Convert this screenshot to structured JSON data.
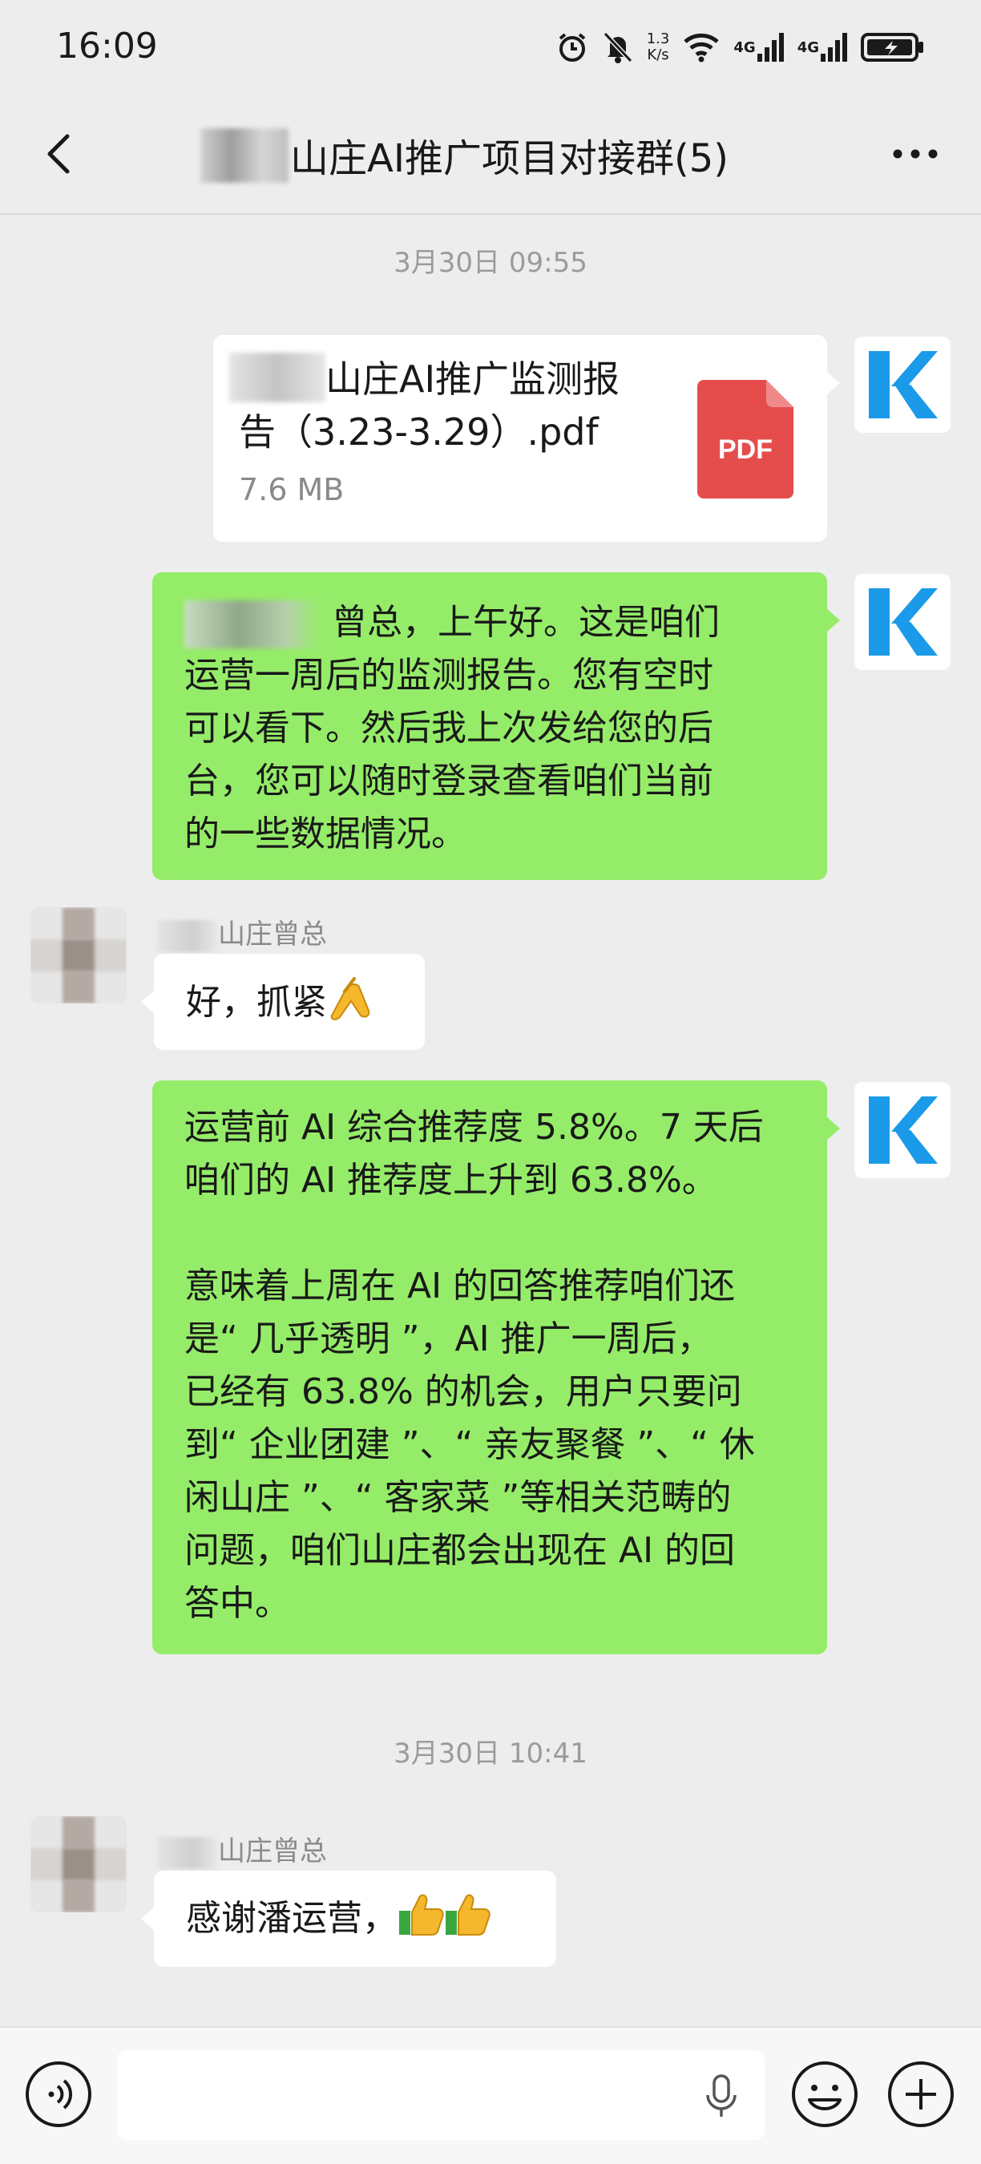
{
  "status_bar": {
    "time": "16:09",
    "net_speed_value": "1.3",
    "net_speed_unit": "K/s",
    "signal1_label": "4G",
    "signal2_label": "4G"
  },
  "nav": {
    "title": "山庄AI推广项目对接群(5)"
  },
  "messages": {
    "timestamp_1": "3月30日 09:55",
    "file": {
      "name_line1": "山庄AI推广监测报",
      "name_line2": "告（3.23-3.29）.pdf",
      "size": "7.6 MB",
      "icon_label": "PDF"
    },
    "msg2_lines": [
      "曾总，上午好。这是咱们",
      "运营一周后的监测报告。您有空时",
      "可以看下。然后我上次发给您的后",
      "台，您可以随时登录查看咱们当前",
      "的一些数据情况。"
    ],
    "sender_1": "山庄曾总",
    "msg3": "好，抓紧",
    "msg4_lines": [
      "运营前 AI 综合推荐度 5.8%。7 天后",
      "咱们的 AI 推荐度上升到 63.8%。",
      "",
      "意味着上周在 AI 的回答推荐咱们还",
      "是“ 几乎透明 ”，AI 推广一周后，",
      "已经有 63.8% 的机会，用户只要问",
      "到“ 企业团建 ”、“ 亲友聚餐 ”、“ 休",
      "闲山庄 ”、“ 客家菜 ”等相关范畴的",
      "问题，咱们山庄都会出现在 AI 的回",
      "答中。"
    ],
    "timestamp_2": "3月30日 10:41",
    "sender_2": "山庄曾总",
    "msg5": "感谢潘运营，"
  },
  "input_bar": {
    "placeholder": ""
  },
  "colors": {
    "bubble_green": "#95ec69",
    "background": "#ededed",
    "kuaishou_blue": "#1a9ae8",
    "pdf_red": "#e54d4d"
  },
  "icons": [
    "back-icon",
    "more-icon",
    "k-logo-icon",
    "pdf-icon",
    "voice-icon",
    "mic-icon",
    "emoji-icon",
    "plus-icon",
    "alarm-icon",
    "mute-icon",
    "wifi-icon",
    "signal-icon",
    "battery-icon",
    "pinched-hand-emoji",
    "thumbs-up-emoji"
  ]
}
